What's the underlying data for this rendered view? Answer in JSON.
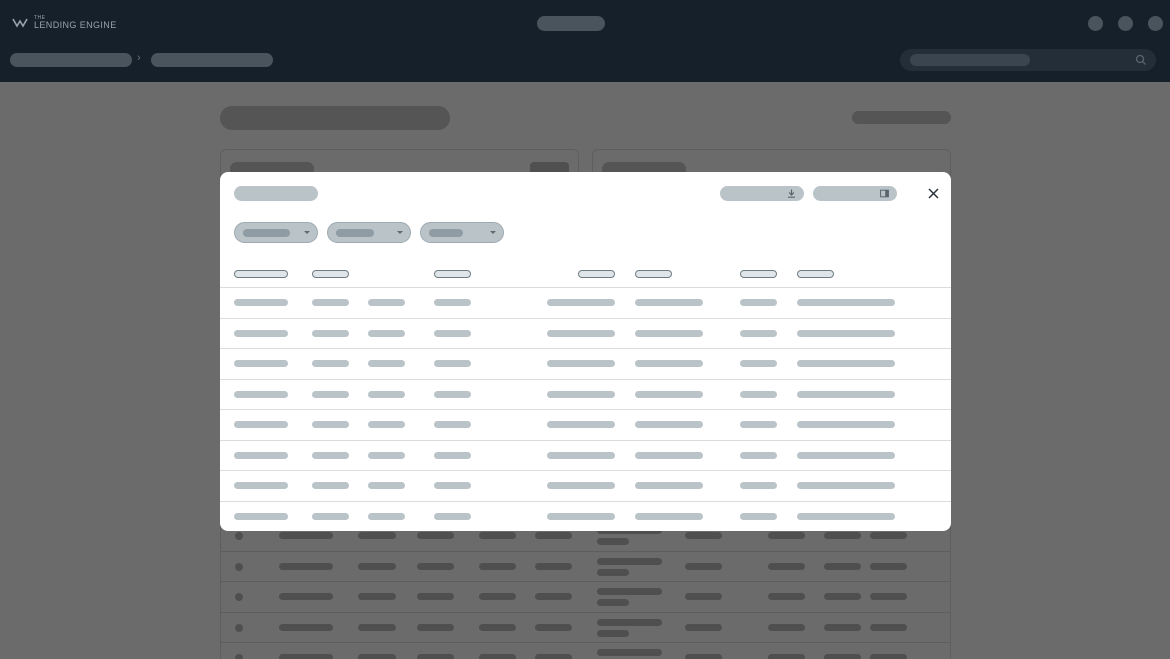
{
  "header": {
    "logo_small": "THE",
    "logo_main": "LENDING ENGINE",
    "breadcrumb_separator": "›"
  },
  "modal": {
    "close_label": "×",
    "filters": [
      {
        "name": "filter-dropdown-1"
      },
      {
        "name": "filter-dropdown-2"
      },
      {
        "name": "filter-dropdown-3"
      }
    ],
    "action_icons": [
      "download-icon",
      "panel-icon"
    ],
    "row_count": 8
  },
  "colors": {
    "header_bg": "#16202a",
    "overlay": "#6b6b6b",
    "modal_bg": "#ffffff",
    "placeholder": "#b9c3c8"
  }
}
